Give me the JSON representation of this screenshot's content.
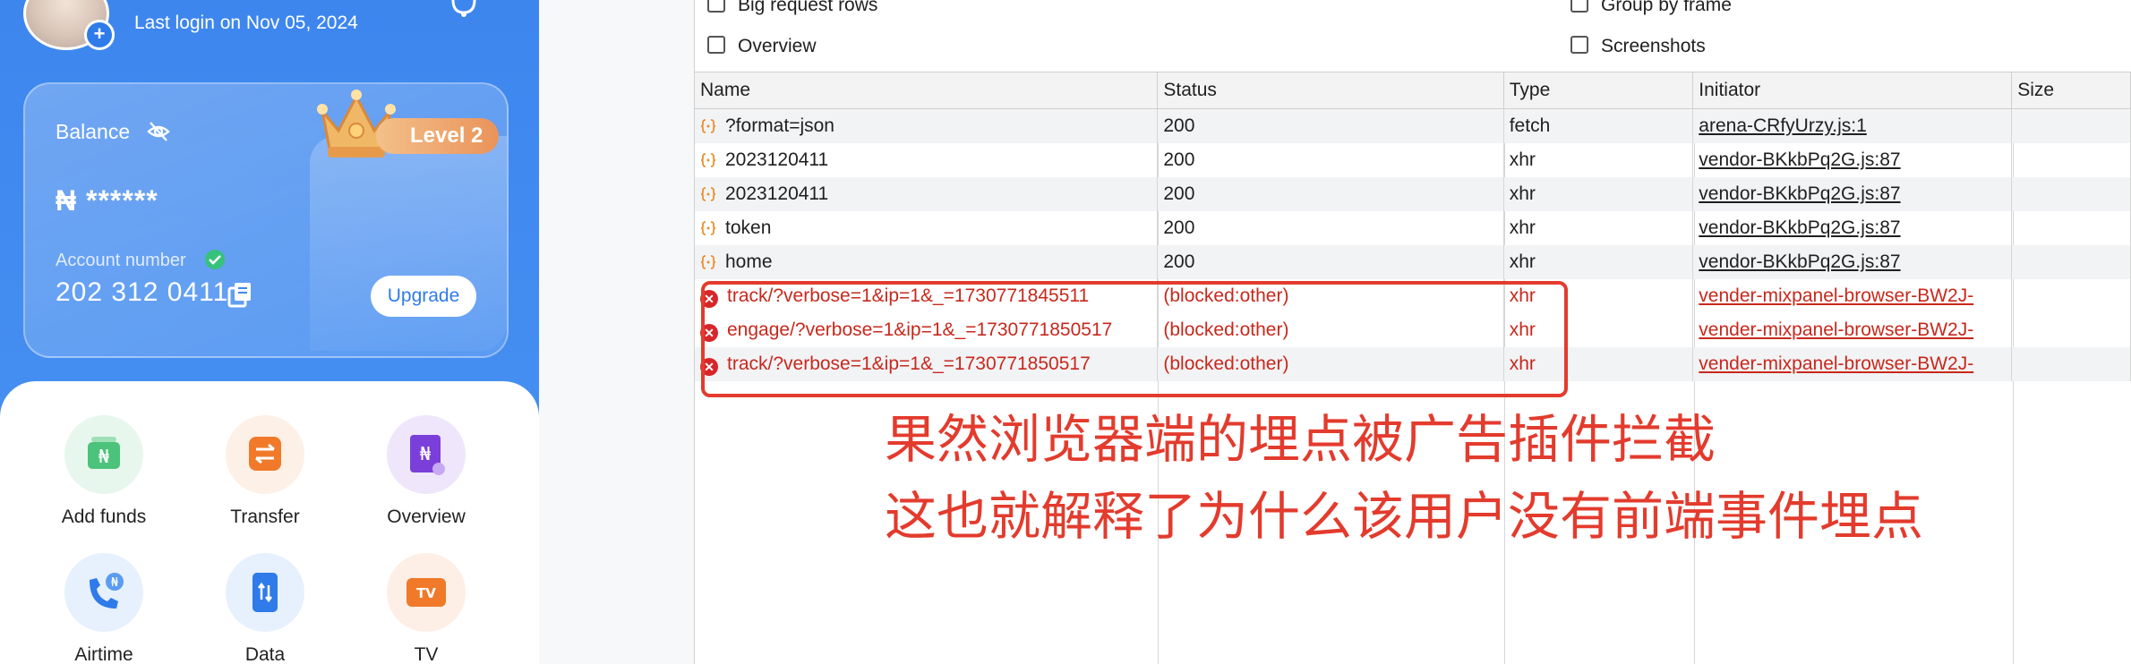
{
  "profile": {
    "last_login": "Last login on Nov 05, 2024",
    "avatar_plus": "+"
  },
  "balance": {
    "label": "Balance",
    "amount": "₦ ******",
    "level": "Level 2",
    "account_label": "Account number",
    "account_number": "202 312 0411",
    "upgrade": "Upgrade"
  },
  "actions": [
    {
      "label": "Add funds",
      "icon": "add-funds-icon"
    },
    {
      "label": "Transfer",
      "icon": "transfer-icon"
    },
    {
      "label": "Overview",
      "icon": "overview-icon"
    },
    {
      "label": "Airtime",
      "icon": "airtime-icon"
    },
    {
      "label": "Data",
      "icon": "data-icon"
    },
    {
      "label": "TV",
      "icon": "tv-icon"
    }
  ],
  "devtools": {
    "options": {
      "big_request_rows": "Big request rows",
      "group_by_frame": "Group by frame",
      "overview": "Overview",
      "screenshots": "Screenshots"
    },
    "columns": [
      "Name",
      "Status",
      "Type",
      "Initiator",
      "Size"
    ],
    "rows": [
      {
        "name": "?format=json",
        "status": "200",
        "type": "fetch",
        "initiator": "arena-CRfyUrzy.js:1"
      },
      {
        "name": "2023120411",
        "status": "200",
        "type": "xhr",
        "initiator": "vendor-BKkbPq2G.js:87"
      },
      {
        "name": "2023120411",
        "status": "200",
        "type": "xhr",
        "initiator": "vendor-BKkbPq2G.js:87"
      },
      {
        "name": "token",
        "status": "200",
        "type": "xhr",
        "initiator": "vendor-BKkbPq2G.js:87"
      },
      {
        "name": "home",
        "status": "200",
        "type": "xhr",
        "initiator": "vendor-BKkbPq2G.js:87"
      },
      {
        "name": "track/?verbose=1&ip=1&_=1730771845511",
        "status": "(blocked:other)",
        "type": "xhr",
        "initiator": "vender-mixpanel-browser-BW2J-"
      },
      {
        "name": "engage/?verbose=1&ip=1&_=1730771850517",
        "status": "(blocked:other)",
        "type": "xhr",
        "initiator": "vender-mixpanel-browser-BW2J-"
      },
      {
        "name": "track/?verbose=1&ip=1&_=1730771850517",
        "status": "(blocked:other)",
        "type": "xhr",
        "initiator": "vender-mixpanel-browser-BW2J-"
      }
    ]
  },
  "annotation": {
    "line1": "果然浏览器端的埋点被广告插件拦截",
    "line2": "这也就解释了为什么该用户没有前端事件埋点",
    "color": "#e33b2d"
  }
}
